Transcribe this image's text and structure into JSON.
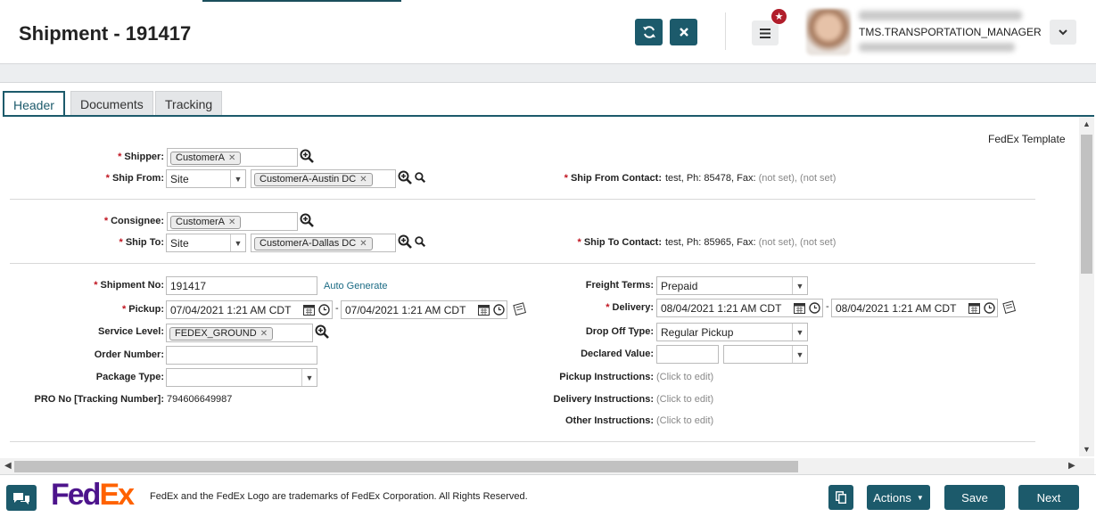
{
  "header": {
    "title": "Shipment - 191417",
    "refresh_icon": "refresh-icon",
    "close_icon": "close-icon",
    "menu_icon": "hamburger-icon",
    "badge_icon": "star-icon",
    "user_role": "TMS.TRANSPORTATION_MANAGER",
    "user_dropdown_icon": "chevron-down-icon"
  },
  "tabs": [
    {
      "label": "Header",
      "active": true
    },
    {
      "label": "Documents",
      "active": false
    },
    {
      "label": "Tracking",
      "active": false
    }
  ],
  "template_label": "FedEx Template",
  "shipper": {
    "label": "Shipper:",
    "value": "CustomerA",
    "ship_from_label": "Ship From:",
    "ship_from_type": "Site",
    "ship_from_value": "CustomerA-Austin DC",
    "contact_label": "Ship From Contact:",
    "contact_value": "test, Ph: 85478, Fax:",
    "contact_notset1": "(not set),",
    "contact_notset2": "(not set)"
  },
  "consignee": {
    "label": "Consignee:",
    "value": "CustomerA",
    "ship_to_label": "Ship To:",
    "ship_to_type": "Site",
    "ship_to_value": "CustomerA-Dallas DC",
    "contact_label": "Ship To Contact:",
    "contact_value": "test, Ph: 85965, Fax:",
    "contact_notset1": "(not set),",
    "contact_notset2": "(not set)"
  },
  "details": {
    "shipment_no_label": "Shipment No:",
    "shipment_no": "191417",
    "auto_generate": "Auto Generate",
    "pickup_label": "Pickup:",
    "pickup_from": "07/04/2021 1:21 AM CDT",
    "pickup_to": "07/04/2021 1:21 AM CDT",
    "service_level_label": "Service Level:",
    "service_level": "FEDEX_GROUND",
    "order_number_label": "Order Number:",
    "order_number": "",
    "package_type_label": "Package Type:",
    "package_type": "",
    "pro_no_label": "PRO No [Tracking Number]:",
    "pro_no": "794606649987",
    "freight_terms_label": "Freight Terms:",
    "freight_terms": "Prepaid",
    "delivery_label": "Delivery:",
    "delivery_from": "08/04/2021 1:21 AM CDT",
    "delivery_to": "08/04/2021 1:21 AM CDT",
    "drop_off_label": "Drop Off Type:",
    "drop_off": "Regular Pickup",
    "declared_value_label": "Declared Value:",
    "declared_value": "",
    "declared_currency": "",
    "pickup_instr_label": "Pickup Instructions:",
    "delivery_instr_label": "Delivery Instructions:",
    "other_instr_label": "Other Instructions:",
    "click_to_edit": "(Click to edit)",
    "date_separator": "-"
  },
  "footer": {
    "logo_fe": "Fed",
    "logo_ex": "Ex",
    "trademark": "FedEx and the FedEx Logo are trademarks of FedEx Corporation. All Rights Reserved.",
    "actions_label": "Actions",
    "save_label": "Save",
    "next_label": "Next"
  },
  "colors": {
    "primary": "#1c5a6b",
    "required": "#c0131f",
    "badge": "#b11e2b",
    "fedex_purple": "#4d148c",
    "fedex_orange": "#ff6200"
  }
}
